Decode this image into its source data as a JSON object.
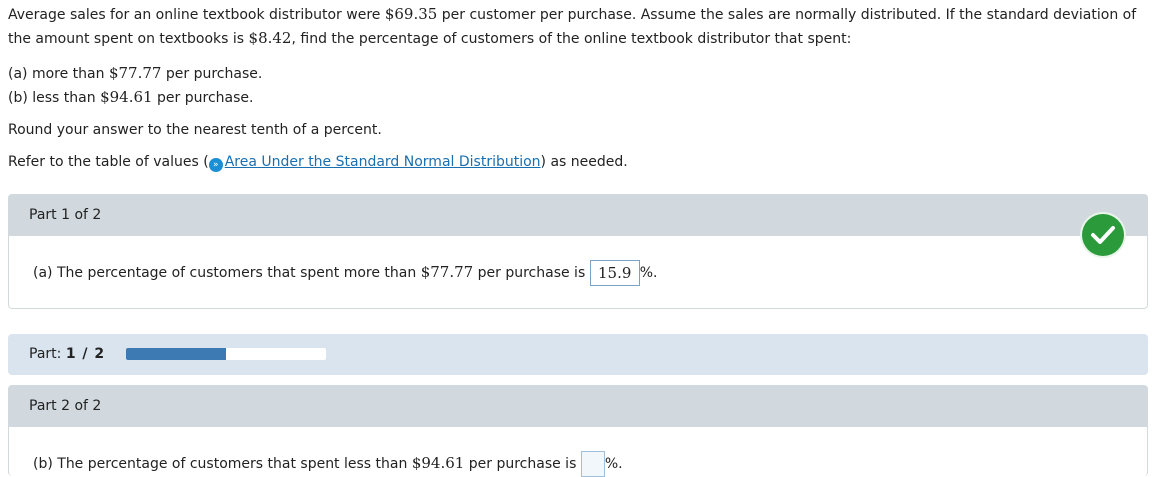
{
  "question": {
    "stem_1": "Average sales for an online textbook distributor were ",
    "mean_amount": "$69.35",
    "stem_2": " per customer per purchase. Assume the sales are normally distributed. If the standard deviation of the amount spent on textbooks is ",
    "sd_amount": "$8.42",
    "stem_3": ", find the percentage of customers of the online textbook distributor that spent:",
    "option_a_prefix": "(a) more than ",
    "option_a_amount": "$77.77",
    "option_a_suffix": " per purchase.",
    "option_b_prefix": "(b) less than ",
    "option_b_amount": "$94.61",
    "option_b_suffix": " per purchase.",
    "rounding_note": "Round your answer to the nearest tenth of a percent.",
    "refer_prefix": "Refer to the table of values (",
    "refer_link": "Area Under the Standard Normal Distribution",
    "refer_suffix": ") as needed."
  },
  "part1": {
    "header": "Part 1 of 2",
    "text_prefix": "(a) The percentage of customers that spent more than ",
    "amount": "$77.77",
    "text_mid": " per purchase is ",
    "answer": "15.9",
    "suffix": "%.",
    "status": "correct"
  },
  "progress": {
    "label": "Part: ",
    "value_text": "1 / 2",
    "fraction": 0.5
  },
  "part2": {
    "header": "Part 2 of 2",
    "text_prefix": "(b) The percentage of customers that spent less than ",
    "amount": "$94.61",
    "text_mid": " per purchase is ",
    "answer": "",
    "suffix": "%."
  },
  "icons": {
    "info": "info-circle-icon",
    "check": "checkmark-circle-icon"
  },
  "colors": {
    "link": "#1a6fb0",
    "check_green": "#2a9a3a",
    "progress_fill": "#3d79b3",
    "part_header_bg": "#d1d9de",
    "progress_bg": "#dae4ee"
  }
}
